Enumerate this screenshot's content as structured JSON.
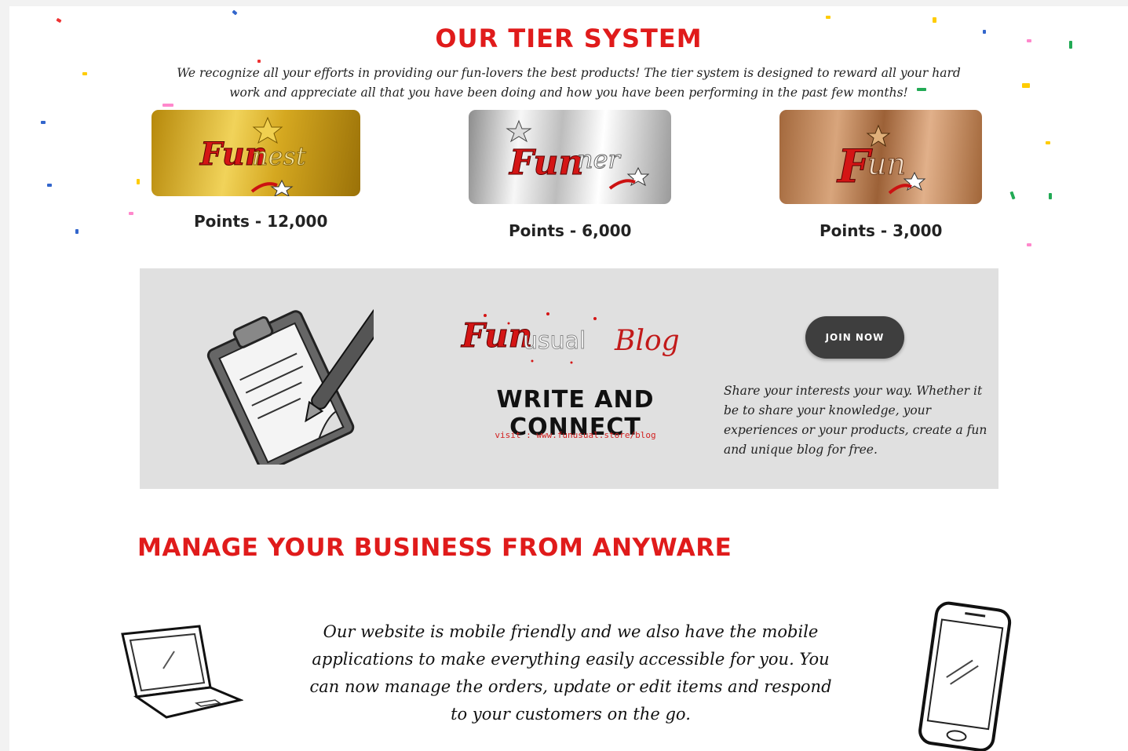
{
  "tiers": {
    "title": "OUR TIER SYSTEM",
    "description": "We recognize all your efforts in providing our fun-lovers the best products! The tier system is designed to reward all your hard work and appreciate all that you have been doing and how you have been performing in the past few months!",
    "cards": [
      {
        "logo_lead": "Fun",
        "logo_rest": "nest",
        "points": "Points  - 12,000"
      },
      {
        "logo_lead": "Fun",
        "logo_rest": "ner",
        "points": "Points  - 6,000"
      },
      {
        "logo_lead": "F",
        "logo_rest": "un",
        "points": "Points  - 3,000"
      }
    ]
  },
  "blog": {
    "logo_lead": "Fun",
    "logo_mid": "usual",
    "logo_word": "Blog",
    "heading": "WRITE AND CONNECT",
    "visit": "visit : www.funusual.store/blog",
    "join_label": "JOIN NOW",
    "description": "Share your interests your way. Whether it be to share your knowledge, your experiences or your products, create a fun and unique blog for free."
  },
  "manage": {
    "title": "MANAGE YOUR BUSINESS FROM ANYWARE",
    "description": "Our website is mobile friendly and we also have the mobile applications to make everything easily accessible for you. You can now manage the orders, update or edit items and respond to your customers on the go."
  },
  "colors": {
    "accent_red": "#e01b1b",
    "banner_gray": "#e0e0e0",
    "button_dark": "#3e3e3e"
  }
}
